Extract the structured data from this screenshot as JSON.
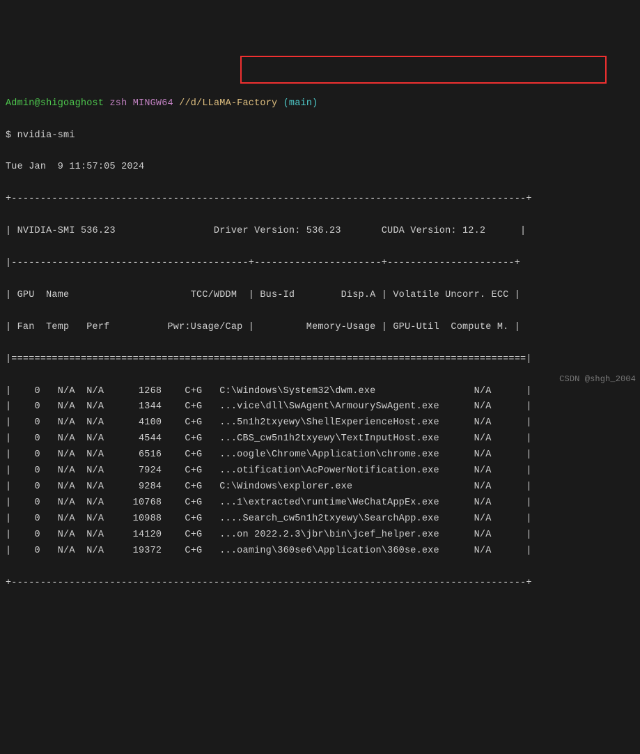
{
  "prompt": {
    "user_host": "Admin@shigoaghost",
    "sep": " ",
    "shell": "zsh",
    "shell_suffix": " MINGW64 ",
    "cwd": "//d/LLaMA-Factory",
    "branch": " (main)",
    "symbol": "$ ",
    "command": "nvidia-smi"
  },
  "timestamp": "Tue Jan  9 11:57:05 2024",
  "border_top": "+-----------------------------------------------------------------------------------------+",
  "header_line": "| NVIDIA-SMI 536.23                 Driver Version: 536.23       CUDA Version: 12.2      |",
  "sep_mid": "|-----------------------------------------+----------------------+----------------------+",
  "col_head_1": "| GPU  Name                     TCC/WDDM  | Bus-Id        Disp.A | Volatile Uncorr. ECC |",
  "col_head_2": "| Fan  Temp   Perf          Pwr:Usage/Cap |         Memory-Usage | GPU-Util  Compute M. |",
  "sep_double": "|=========================================================================================|",
  "processes": [
    {
      "gpu": "0",
      "gi": "N/A",
      "ci": "N/A",
      "pid": "1268",
      "type": "C+G",
      "name": "C:\\Windows\\System32\\dwm.exe             ",
      "mem": "N/A"
    },
    {
      "gpu": "0",
      "gi": "N/A",
      "ci": "N/A",
      "pid": "1344",
      "type": "C+G",
      "name": "...vice\\dll\\SwAgent\\ArmourySwAgent.exe  ",
      "mem": "N/A"
    },
    {
      "gpu": "0",
      "gi": "N/A",
      "ci": "N/A",
      "pid": "4100",
      "type": "C+G",
      "name": "...5n1h2txyewy\\ShellExperienceHost.exe  ",
      "mem": "N/A"
    },
    {
      "gpu": "0",
      "gi": "N/A",
      "ci": "N/A",
      "pid": "4544",
      "type": "C+G",
      "name": "...CBS_cw5n1h2txyewy\\TextInputHost.exe  ",
      "mem": "N/A"
    },
    {
      "gpu": "0",
      "gi": "N/A",
      "ci": "N/A",
      "pid": "6516",
      "type": "C+G",
      "name": "...oogle\\Chrome\\Application\\chrome.exe  ",
      "mem": "N/A"
    },
    {
      "gpu": "0",
      "gi": "N/A",
      "ci": "N/A",
      "pid": "7924",
      "type": "C+G",
      "name": "...otification\\AcPowerNotification.exe  ",
      "mem": "N/A"
    },
    {
      "gpu": "0",
      "gi": "N/A",
      "ci": "N/A",
      "pid": "9284",
      "type": "C+G",
      "name": "C:\\Windows\\explorer.exe                 ",
      "mem": "N/A"
    },
    {
      "gpu": "0",
      "gi": "N/A",
      "ci": "N/A",
      "pid": "10768",
      "type": "C+G",
      "name": "...1\\extracted\\runtime\\WeChatAppEx.exe  ",
      "mem": "N/A"
    },
    {
      "gpu": "0",
      "gi": "N/A",
      "ci": "N/A",
      "pid": "10988",
      "type": "C+G",
      "name": "....Search_cw5n1h2txyewy\\SearchApp.exe  ",
      "mem": "N/A"
    },
    {
      "gpu": "0",
      "gi": "N/A",
      "ci": "N/A",
      "pid": "14120",
      "type": "C+G",
      "name": "...on 2022.2.3\\jbr\\bin\\jcef_helper.exe  ",
      "mem": "N/A"
    },
    {
      "gpu": "0",
      "gi": "N/A",
      "ci": "N/A",
      "pid": "19372",
      "type": "C+G",
      "name": "...oaming\\360se6\\Application\\360se.exe  ",
      "mem": "N/A"
    }
  ],
  "border_bot": "+-----------------------------------------------------------------------------------------+",
  "watermark": "CSDN @shgh_2004"
}
